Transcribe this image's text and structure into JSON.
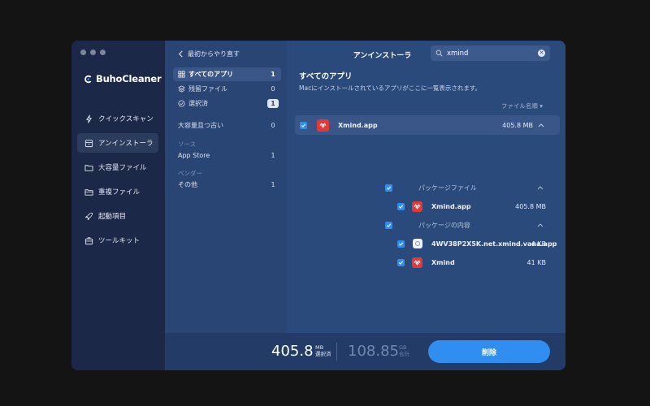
{
  "sidebar": {
    "brand": "BuhoCleaner",
    "items": [
      {
        "label": "クイックスキャン",
        "icon": "bolt-icon"
      },
      {
        "label": "アンインストーラ",
        "icon": "archive-icon"
      },
      {
        "label": "大容量ファイル",
        "icon": "folder-icon"
      },
      {
        "label": "重複ファイル",
        "icon": "duplicate-folder-icon"
      },
      {
        "label": "起動項目",
        "icon": "rocket-icon"
      },
      {
        "label": "ツールキット",
        "icon": "toolbox-icon"
      }
    ]
  },
  "filters": {
    "back_label": "最初からやり直す",
    "categories": [
      {
        "label": "すべてのアプリ",
        "count": "1"
      },
      {
        "label": "残留ファイル",
        "count": "0"
      },
      {
        "label": "選択済",
        "count": "1"
      },
      {
        "label": "大容量且つ古い",
        "count": "0"
      }
    ],
    "source_header": "ソース",
    "sources": [
      {
        "label": "App Store",
        "count": "1"
      }
    ],
    "vendor_header": "ベンダー",
    "vendors": [
      {
        "label": "その他",
        "count": "1"
      }
    ]
  },
  "main": {
    "title": "アンインストーラ",
    "search_value": "xmind",
    "section_title": "すべてのアプリ",
    "section_desc": "Macにインストールされているアプリがここに一覧表示されます。",
    "sort_label": "ファイル名順 ▾",
    "app": {
      "name": "Xmind.app",
      "size": "405.8 MB"
    },
    "groups": [
      {
        "label": "パッケージファイル",
        "items": [
          {
            "name": "Xmind.app",
            "size": "405.8 MB"
          }
        ]
      },
      {
        "label": "パッケージの内容",
        "items": [
          {
            "name": "4WV38P2X5K.net.xmind.vana.app",
            "size": "4 KB"
          },
          {
            "name": "Xmind",
            "size": "41 KB"
          }
        ]
      }
    ]
  },
  "footer": {
    "selected_value": "405.8",
    "selected_unit": "MB",
    "selected_label": "選択済",
    "total_value": "108.85",
    "total_unit": "GB",
    "total_label": "合計",
    "delete_label": "削除"
  },
  "colors": {
    "accent": "#2f8ef0",
    "sidebar": "#1b2847",
    "panel": "#2b4a7c",
    "xmind_red": "#e23a3a"
  }
}
